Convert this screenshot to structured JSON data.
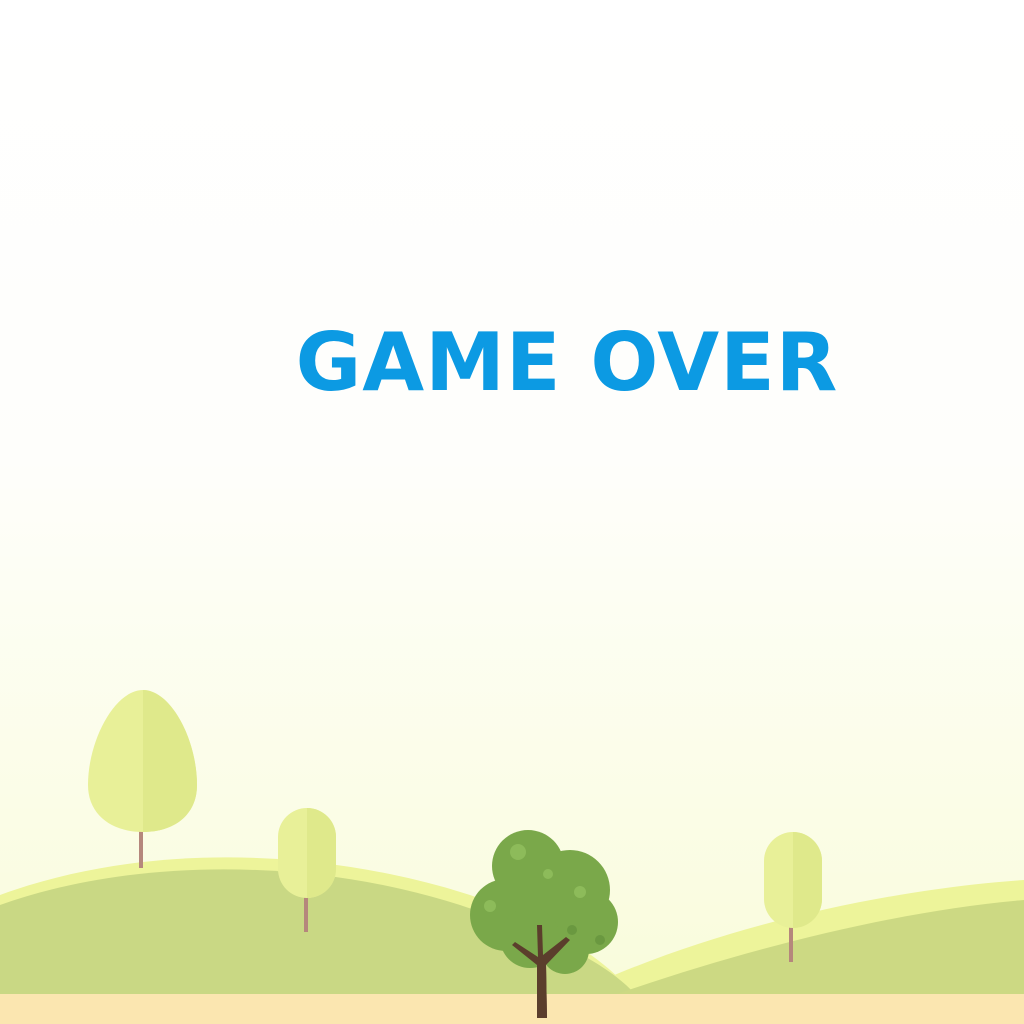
{
  "game": {
    "status_text": "GAME OVER"
  },
  "colors": {
    "title": "#0c9ae3",
    "ground": "#fbe6b0",
    "hill_light": "#edf49a",
    "hill_mid": "#c8d782",
    "tree_light": "#e8f098",
    "tree_dark": "#7aa84a",
    "trunk": "#5b3e2c"
  },
  "icons": {
    "scenery": [
      "tree-icon",
      "hill-icon"
    ]
  }
}
